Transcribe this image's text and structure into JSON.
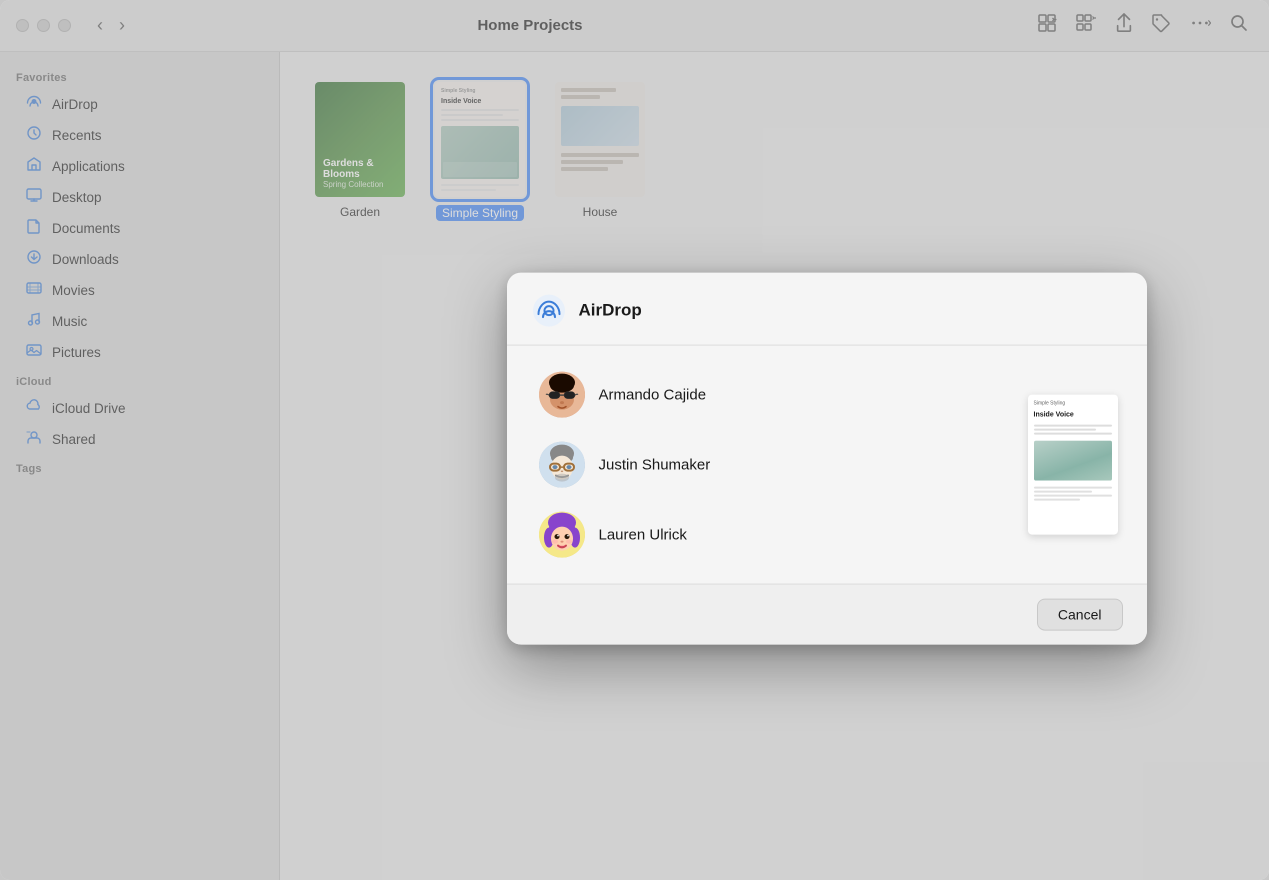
{
  "window": {
    "title": "Home Projects"
  },
  "titlebar": {
    "back_label": "‹",
    "forward_label": "›",
    "title": "Home Projects"
  },
  "sidebar": {
    "favorites_header": "Favorites",
    "icloud_header": "iCloud",
    "tags_header": "Tags",
    "items": [
      {
        "id": "airdrop",
        "label": "AirDrop",
        "icon": "📡"
      },
      {
        "id": "recents",
        "label": "Recents",
        "icon": "🕐"
      },
      {
        "id": "applications",
        "label": "Applications",
        "icon": "🚀"
      },
      {
        "id": "desktop",
        "label": "Desktop",
        "icon": "🖥"
      },
      {
        "id": "documents",
        "label": "Documents",
        "icon": "📄"
      },
      {
        "id": "downloads",
        "label": "Downloads",
        "icon": "⬇"
      },
      {
        "id": "movies",
        "label": "Movies",
        "icon": "🎬"
      },
      {
        "id": "music",
        "label": "Music",
        "icon": "🎵"
      },
      {
        "id": "pictures",
        "label": "Pictures",
        "icon": "🖼"
      }
    ],
    "icloud_items": [
      {
        "id": "icloud-drive",
        "label": "iCloud Drive",
        "icon": "☁"
      },
      {
        "id": "shared",
        "label": "Shared",
        "icon": "📁"
      }
    ]
  },
  "files": [
    {
      "id": "garden",
      "label": "Garden",
      "selected": false
    },
    {
      "id": "simple-styling",
      "label": "Simple Styling",
      "selected": true
    },
    {
      "id": "house",
      "label": "House",
      "selected": false
    }
  ],
  "airdrop_dialog": {
    "title": "AirDrop",
    "contacts": [
      {
        "id": "armando",
        "name": "Armando Cajide"
      },
      {
        "id": "justin",
        "name": "Justin Shumaker"
      },
      {
        "id": "lauren",
        "name": "Lauren Ulrick"
      }
    ],
    "preview": {
      "title_small": "Simple Styling",
      "title_large": "Inside Voice"
    },
    "cancel_label": "Cancel"
  }
}
